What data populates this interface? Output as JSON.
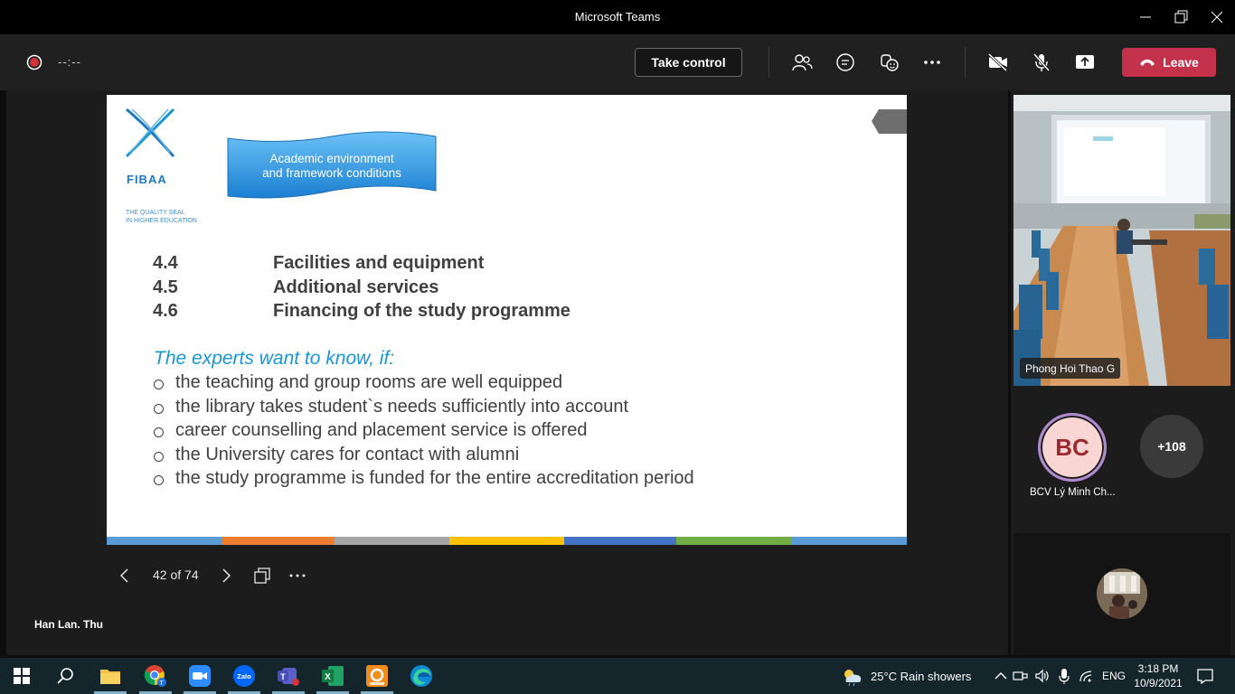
{
  "window": {
    "title": "Microsoft Teams"
  },
  "toolbar": {
    "timer": "--:--",
    "take_control_label": "Take control",
    "leave_label": "Leave",
    "icons": [
      "record-icon",
      "participants-icon",
      "chat-icon",
      "reactions-icon",
      "more-icon",
      "camera-off-icon",
      "mic-off-icon",
      "share-icon",
      "phone-icon"
    ]
  },
  "slide": {
    "logo_text": "FIBAA",
    "seal_line1": "THE QUALITY SEAL",
    "seal_line2": "IN HIGHER EDUCATION",
    "banner_line1": "Academic environment",
    "banner_line2": "and framework conditions",
    "sections": [
      {
        "num": "4.4",
        "title": "Facilities and equipment"
      },
      {
        "num": "4.5",
        "title": "Additional services"
      },
      {
        "num": "4.6",
        "title": "Financing of the study programme"
      }
    ],
    "question": "The experts want to know, if:",
    "bullets": [
      "the teaching and group rooms are well equipped",
      "the library takes student`s needs sufficiently into account",
      "career counselling and placement service is offered",
      "the University cares for contact with alumni",
      "the study programme is funded for the entire accreditation period"
    ],
    "stripe_colors": [
      "#5b9bd5",
      "#ed7d31",
      "#a5a5a5",
      "#ffc000",
      "#4472c4",
      "#70ad47",
      "#5b9bd5"
    ]
  },
  "slide_nav": {
    "page_label": "42 of 74"
  },
  "presenter_name": "Han Lan. Thu",
  "participants": {
    "video_name": "Phong Hoi Thao G",
    "avatar_initials": "BC",
    "avatar_name": "BCV Lý Minh Ch...",
    "more_count": "+108"
  },
  "taskbar": {
    "apps": [
      "file-explorer-icon",
      "chrome-icon",
      "zoom-icon",
      "zalo-icon",
      "teams-icon",
      "excel-icon",
      "foxit-pdf-icon",
      "edge-icon"
    ],
    "zalo_label": "Zalo",
    "weather": "25°C  Rain showers",
    "language": "ENG",
    "time": "3:18 PM",
    "date": "10/9/2021"
  },
  "colors": {
    "leave": "#c4314b",
    "accent_blue": "#1997d4",
    "fibaa_blue": "#1f79c0"
  }
}
